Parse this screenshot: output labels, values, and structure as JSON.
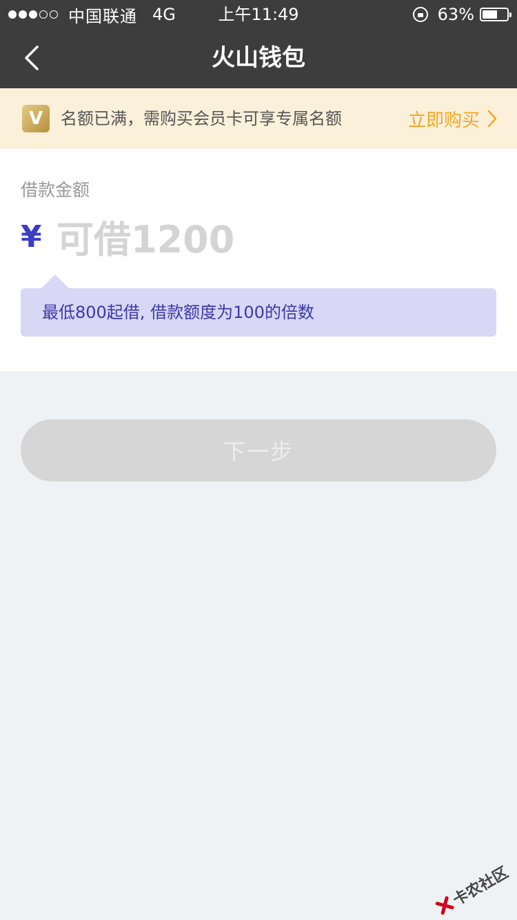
{
  "status_bar": {
    "carrier": "中国联通",
    "network": "4G",
    "time": "上午11:49",
    "battery": "63%",
    "battery_level": 0.63,
    "signal_bars_filled": 3,
    "signal_bars_total": 5
  },
  "nav": {
    "title": "火山钱包",
    "back_icon": "chevron-left-icon"
  },
  "banner": {
    "badge": "V",
    "message": "名额已满，需购买会员卡可享专属名额",
    "link_label": "立即购买",
    "link_color": "#f5a623"
  },
  "loan": {
    "label": "借款金额",
    "currency": "¥",
    "placeholder": "可借1200",
    "value": "",
    "hint": "最低800起借, 借款额度为100的倍数"
  },
  "actions": {
    "next_label": "下一步"
  },
  "watermark": {
    "text": "卡农社区"
  }
}
